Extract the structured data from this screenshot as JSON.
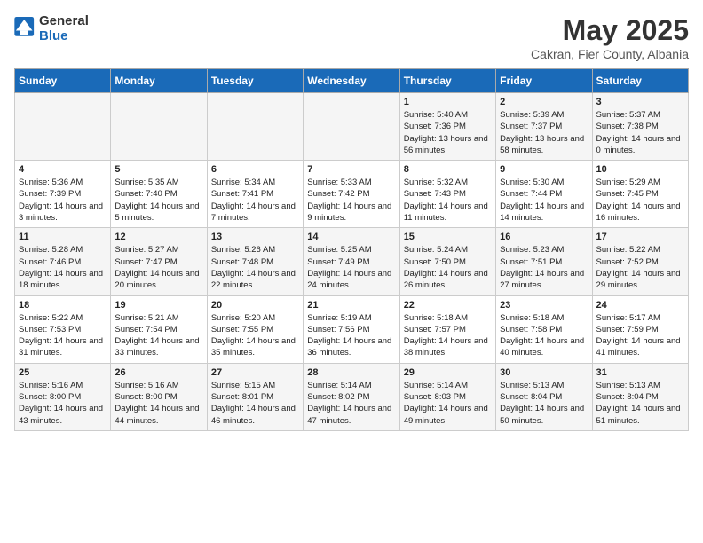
{
  "header": {
    "logo_general": "General",
    "logo_blue": "Blue",
    "month_title": "May 2025",
    "location": "Cakran, Fier County, Albania"
  },
  "days_of_week": [
    "Sunday",
    "Monday",
    "Tuesday",
    "Wednesday",
    "Thursday",
    "Friday",
    "Saturday"
  ],
  "weeks": [
    [
      {
        "day": "",
        "content": ""
      },
      {
        "day": "",
        "content": ""
      },
      {
        "day": "",
        "content": ""
      },
      {
        "day": "",
        "content": ""
      },
      {
        "day": "1",
        "content": "Sunrise: 5:40 AM\nSunset: 7:36 PM\nDaylight: 13 hours and 56 minutes."
      },
      {
        "day": "2",
        "content": "Sunrise: 5:39 AM\nSunset: 7:37 PM\nDaylight: 13 hours and 58 minutes."
      },
      {
        "day": "3",
        "content": "Sunrise: 5:37 AM\nSunset: 7:38 PM\nDaylight: 14 hours and 0 minutes."
      }
    ],
    [
      {
        "day": "4",
        "content": "Sunrise: 5:36 AM\nSunset: 7:39 PM\nDaylight: 14 hours and 3 minutes."
      },
      {
        "day": "5",
        "content": "Sunrise: 5:35 AM\nSunset: 7:40 PM\nDaylight: 14 hours and 5 minutes."
      },
      {
        "day": "6",
        "content": "Sunrise: 5:34 AM\nSunset: 7:41 PM\nDaylight: 14 hours and 7 minutes."
      },
      {
        "day": "7",
        "content": "Sunrise: 5:33 AM\nSunset: 7:42 PM\nDaylight: 14 hours and 9 minutes."
      },
      {
        "day": "8",
        "content": "Sunrise: 5:32 AM\nSunset: 7:43 PM\nDaylight: 14 hours and 11 minutes."
      },
      {
        "day": "9",
        "content": "Sunrise: 5:30 AM\nSunset: 7:44 PM\nDaylight: 14 hours and 14 minutes."
      },
      {
        "day": "10",
        "content": "Sunrise: 5:29 AM\nSunset: 7:45 PM\nDaylight: 14 hours and 16 minutes."
      }
    ],
    [
      {
        "day": "11",
        "content": "Sunrise: 5:28 AM\nSunset: 7:46 PM\nDaylight: 14 hours and 18 minutes."
      },
      {
        "day": "12",
        "content": "Sunrise: 5:27 AM\nSunset: 7:47 PM\nDaylight: 14 hours and 20 minutes."
      },
      {
        "day": "13",
        "content": "Sunrise: 5:26 AM\nSunset: 7:48 PM\nDaylight: 14 hours and 22 minutes."
      },
      {
        "day": "14",
        "content": "Sunrise: 5:25 AM\nSunset: 7:49 PM\nDaylight: 14 hours and 24 minutes."
      },
      {
        "day": "15",
        "content": "Sunrise: 5:24 AM\nSunset: 7:50 PM\nDaylight: 14 hours and 26 minutes."
      },
      {
        "day": "16",
        "content": "Sunrise: 5:23 AM\nSunset: 7:51 PM\nDaylight: 14 hours and 27 minutes."
      },
      {
        "day": "17",
        "content": "Sunrise: 5:22 AM\nSunset: 7:52 PM\nDaylight: 14 hours and 29 minutes."
      }
    ],
    [
      {
        "day": "18",
        "content": "Sunrise: 5:22 AM\nSunset: 7:53 PM\nDaylight: 14 hours and 31 minutes."
      },
      {
        "day": "19",
        "content": "Sunrise: 5:21 AM\nSunset: 7:54 PM\nDaylight: 14 hours and 33 minutes."
      },
      {
        "day": "20",
        "content": "Sunrise: 5:20 AM\nSunset: 7:55 PM\nDaylight: 14 hours and 35 minutes."
      },
      {
        "day": "21",
        "content": "Sunrise: 5:19 AM\nSunset: 7:56 PM\nDaylight: 14 hours and 36 minutes."
      },
      {
        "day": "22",
        "content": "Sunrise: 5:18 AM\nSunset: 7:57 PM\nDaylight: 14 hours and 38 minutes."
      },
      {
        "day": "23",
        "content": "Sunrise: 5:18 AM\nSunset: 7:58 PM\nDaylight: 14 hours and 40 minutes."
      },
      {
        "day": "24",
        "content": "Sunrise: 5:17 AM\nSunset: 7:59 PM\nDaylight: 14 hours and 41 minutes."
      }
    ],
    [
      {
        "day": "25",
        "content": "Sunrise: 5:16 AM\nSunset: 8:00 PM\nDaylight: 14 hours and 43 minutes."
      },
      {
        "day": "26",
        "content": "Sunrise: 5:16 AM\nSunset: 8:00 PM\nDaylight: 14 hours and 44 minutes."
      },
      {
        "day": "27",
        "content": "Sunrise: 5:15 AM\nSunset: 8:01 PM\nDaylight: 14 hours and 46 minutes."
      },
      {
        "day": "28",
        "content": "Sunrise: 5:14 AM\nSunset: 8:02 PM\nDaylight: 14 hours and 47 minutes."
      },
      {
        "day": "29",
        "content": "Sunrise: 5:14 AM\nSunset: 8:03 PM\nDaylight: 14 hours and 49 minutes."
      },
      {
        "day": "30",
        "content": "Sunrise: 5:13 AM\nSunset: 8:04 PM\nDaylight: 14 hours and 50 minutes."
      },
      {
        "day": "31",
        "content": "Sunrise: 5:13 AM\nSunset: 8:04 PM\nDaylight: 14 hours and 51 minutes."
      }
    ]
  ]
}
